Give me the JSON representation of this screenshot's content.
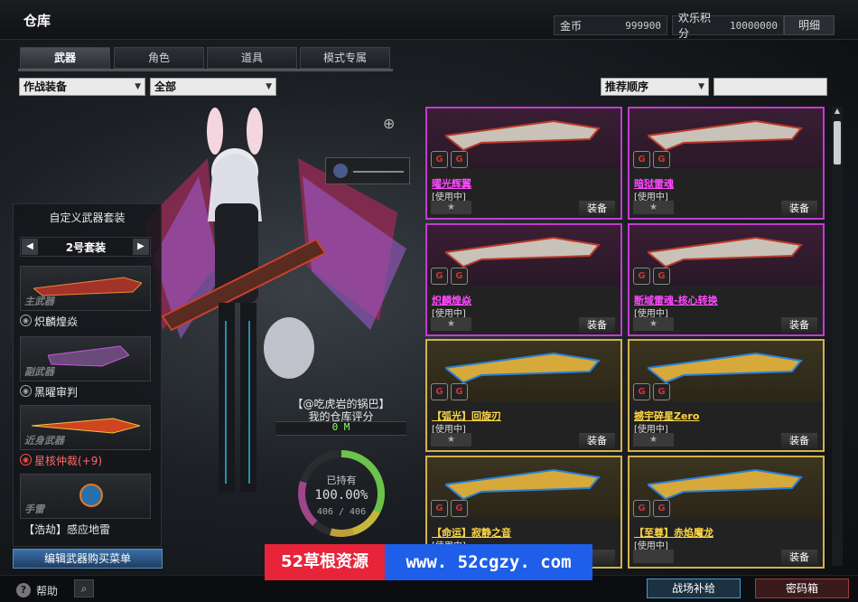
{
  "title": "仓库",
  "currency": {
    "gold_label": "金币",
    "gold_value": "999900",
    "points_label": "欢乐积分",
    "points_value": "10000000",
    "detail_button": "明细"
  },
  "tabs": [
    {
      "label": "武器"
    },
    {
      "label": "角色"
    },
    {
      "label": "道具"
    },
    {
      "label": "模式专属"
    }
  ],
  "filters": {
    "type": "作战装备",
    "category": "全部",
    "sort": "推荐顺序",
    "search_value": ""
  },
  "custom_suit": {
    "title": "自定义武器套装",
    "suit_name": "2号套装",
    "slots": [
      {
        "type": "主武器",
        "name": "炽麟煌焱"
      },
      {
        "type": "副武器",
        "name": "黑曜审判"
      },
      {
        "type": "近身武器",
        "name": "星核仲裁(+9)"
      },
      {
        "type": "手雷",
        "name": "【浩劫】感应地雷"
      }
    ],
    "edit_button": "编辑武器购买菜单"
  },
  "warehouse_score": {
    "owner": "【@吃虎岩的锅巴】",
    "label": "我的仓库评分",
    "value": "0 M"
  },
  "ownership": {
    "label": "已持有",
    "percent": "100.00%",
    "count": "406 / 406",
    "fraction": 1.0
  },
  "items": [
    {
      "name": "曜光辉翼",
      "status": "[使用中]",
      "star": "★",
      "equip": "装备",
      "rarity": "purple"
    },
    {
      "name": "暗狱雷魂",
      "status": "[使用中]",
      "star": "★",
      "equip": "装备",
      "rarity": "purple"
    },
    {
      "name": "炽麟煌焱",
      "status": "[使用中]",
      "star": "★",
      "equip": "装备",
      "rarity": "purple"
    },
    {
      "name": "断域雷魂-核心转换",
      "status": "[使用中]",
      "star": "★",
      "equip": "装备",
      "rarity": "purple"
    },
    {
      "name": "【弧光】回旋刃",
      "status": "[使用中]",
      "star": "★",
      "equip": "装备",
      "rarity": "gold"
    },
    {
      "name": "撼宇碎星Zero",
      "status": "[使用中]",
      "star": "★",
      "equip": "装备",
      "rarity": "gold"
    },
    {
      "name": "【命运】寂静之音",
      "status": "[使用中]",
      "star": "",
      "equip": "",
      "rarity": "gold"
    },
    {
      "name": "【至尊】赤焰魔龙",
      "status": "[使用中]",
      "star": "",
      "equip": "装备",
      "rarity": "gold"
    }
  ],
  "bottom": {
    "help": "帮助",
    "supply_button": "战场补给",
    "password_button": "密码箱"
  },
  "watermark": {
    "left": "52草根资源",
    "right": "www. 52cgzy. com"
  },
  "colors": {
    "accent_purple": "#c43bd0",
    "accent_gold": "#d4b24a",
    "score_green": "#8bff5a"
  }
}
